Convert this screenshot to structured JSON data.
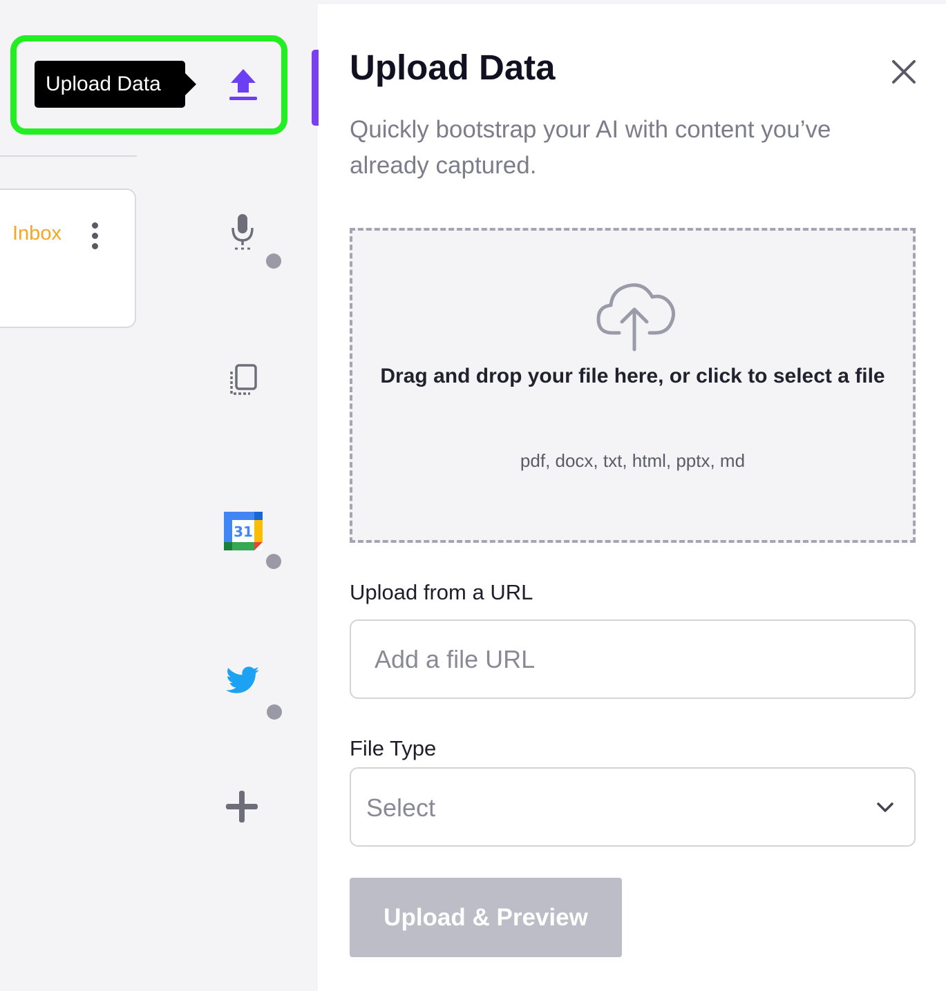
{
  "tooltip": {
    "text": "Upload Data"
  },
  "sidebar": {
    "inbox_label": "Inbox",
    "icons": [
      {
        "name": "upload-icon",
        "color": "#6b3ff2",
        "active": true
      },
      {
        "name": "microphone-icon",
        "status_dot": true
      },
      {
        "name": "copy-document-icon",
        "status_dot": false
      },
      {
        "name": "google-calendar-icon",
        "label": "31",
        "status_dot": true
      },
      {
        "name": "twitter-icon",
        "color": "#1da1f2",
        "status_dot": true
      },
      {
        "name": "plus-icon",
        "status_dot": false
      }
    ]
  },
  "panel": {
    "title": "Upload Data",
    "subtitle": "Quickly bootstrap your AI with content you’ve already captured.",
    "dropzone": {
      "text": "Drag and drop your file here, or click to select a file",
      "file_types": "pdf, docx, txt, html, pptx, md"
    },
    "url": {
      "label": "Upload from a URL",
      "placeholder": "Add a file URL",
      "value": ""
    },
    "file_type": {
      "label": "File Type",
      "value": "Select"
    },
    "submit_label": "Upload & Preview"
  },
  "colors": {
    "accent": "#7b3ff2",
    "highlight": "#22ee22",
    "inbox": "#f5a623",
    "button_disabled": "#bcbdc6"
  }
}
